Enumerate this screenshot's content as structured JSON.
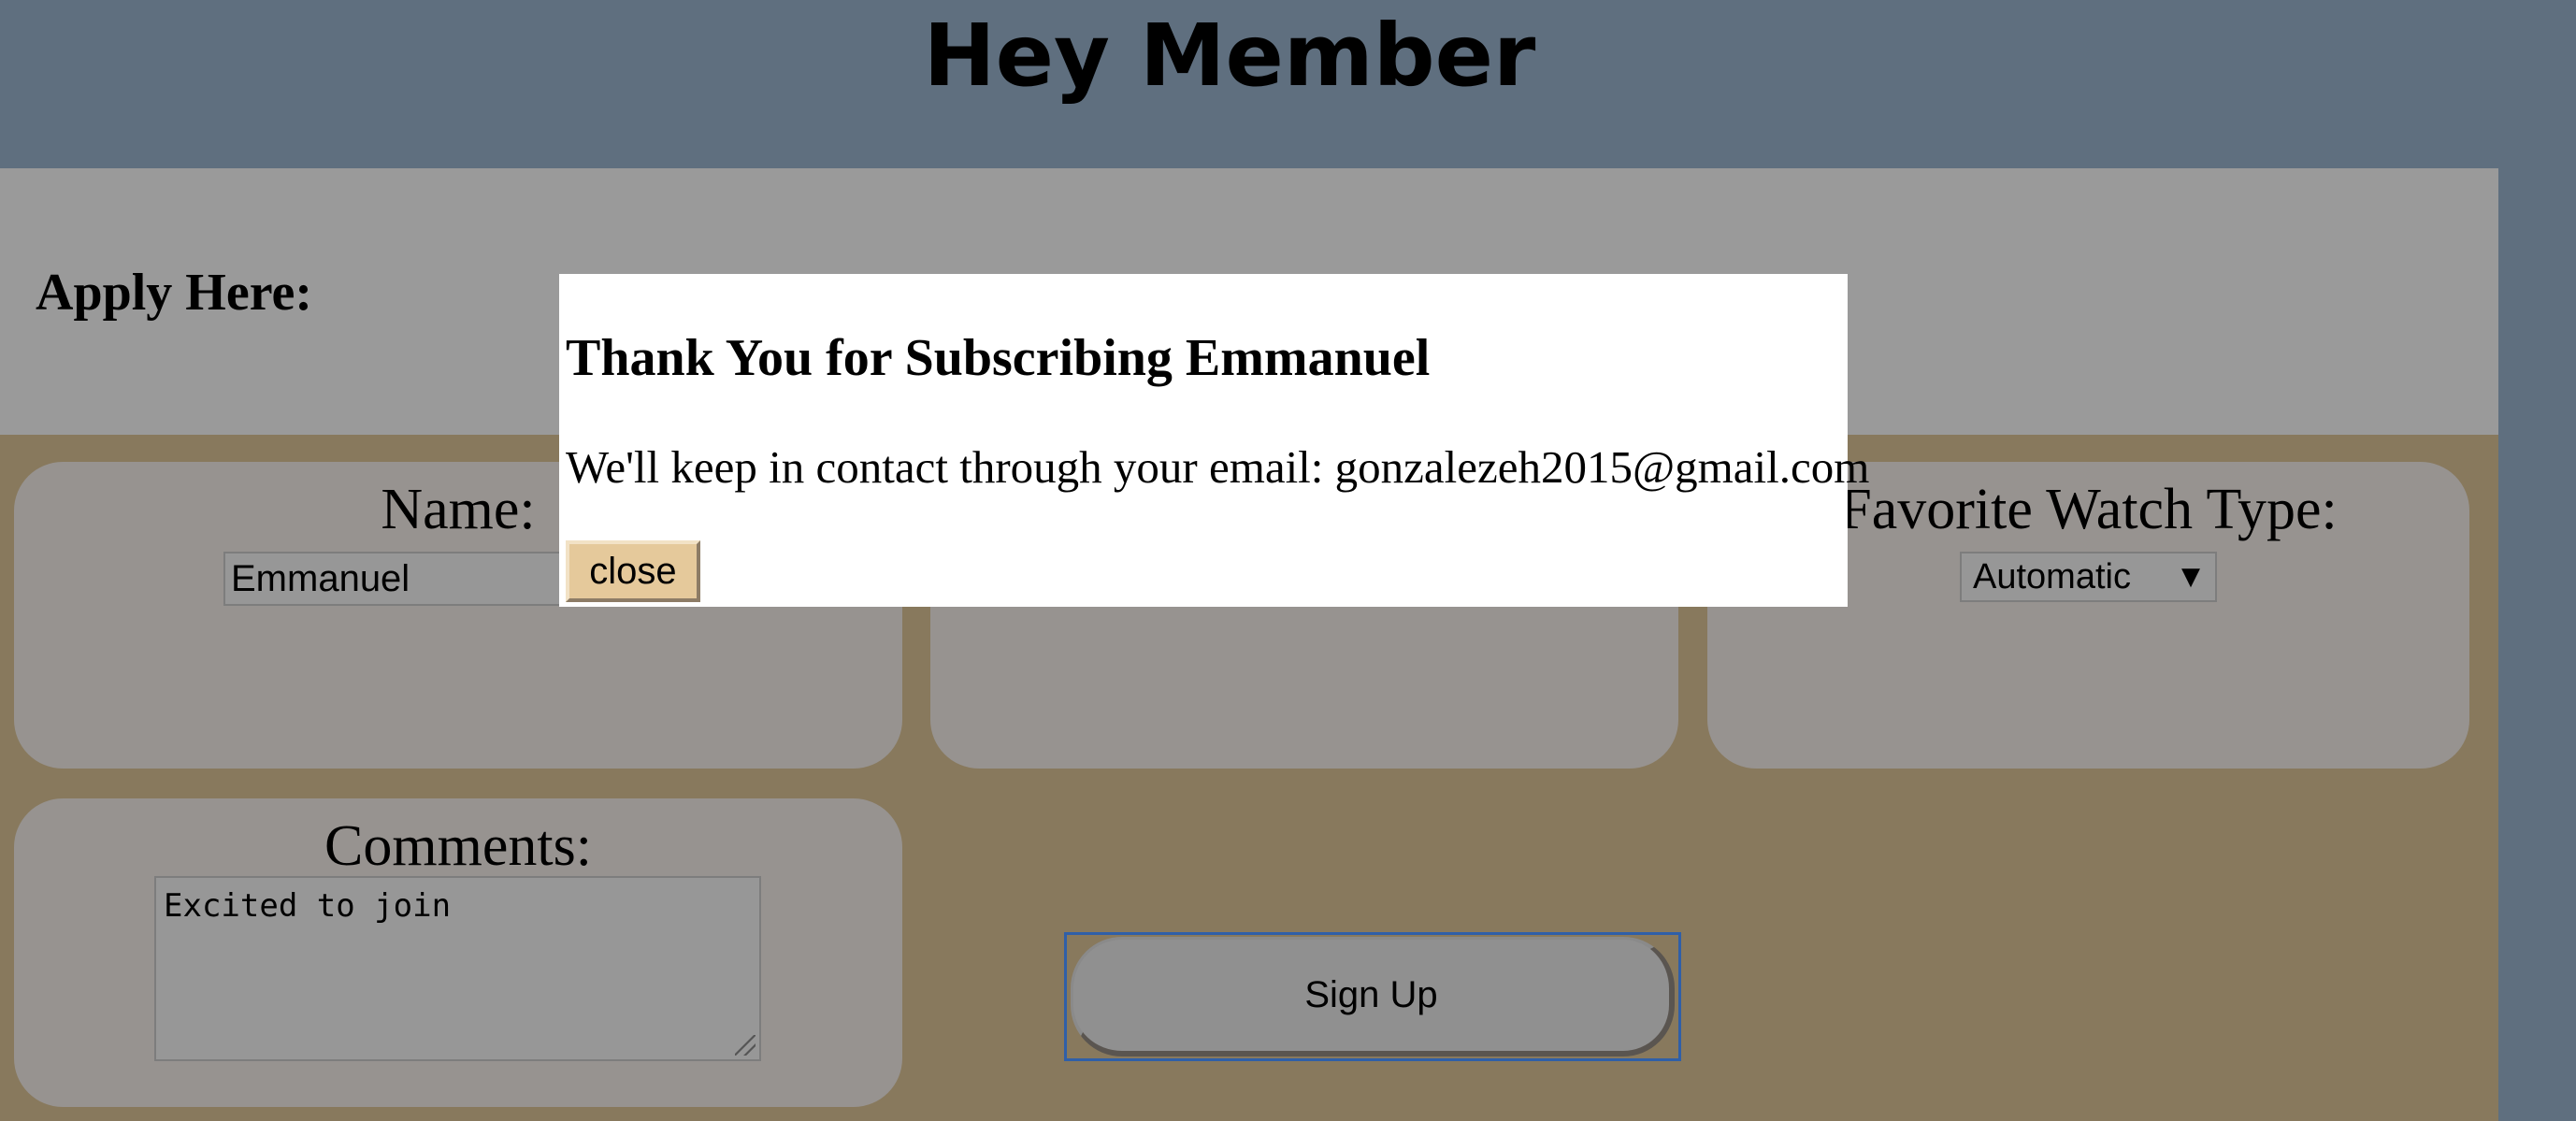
{
  "header": {
    "title": "Hey Member"
  },
  "apply": {
    "label": "Apply Here:"
  },
  "form": {
    "name": {
      "label": "Name:",
      "value": "Emmanuel"
    },
    "watch": {
      "label": "Favorite Watch Type:",
      "selected": "Automatic"
    },
    "comments": {
      "label": "Comments:",
      "value": "Excited to join"
    },
    "signup_label": "Sign Up"
  },
  "modal": {
    "title": "Thank You for Subscribing Emmanuel",
    "message": "We'll keep in contact through your email: gonzalezeh2015@gmail.com",
    "close_label": "close"
  },
  "colors": {
    "header_bg": "#5f6f7f",
    "band_bg": "#9a9a9a",
    "form_bg": "#88795d",
    "card_bg": "#979390",
    "modal_bg": "#ffffff",
    "close_button_bg": "#e5c99b",
    "focus_outline": "#2f5fa8"
  }
}
